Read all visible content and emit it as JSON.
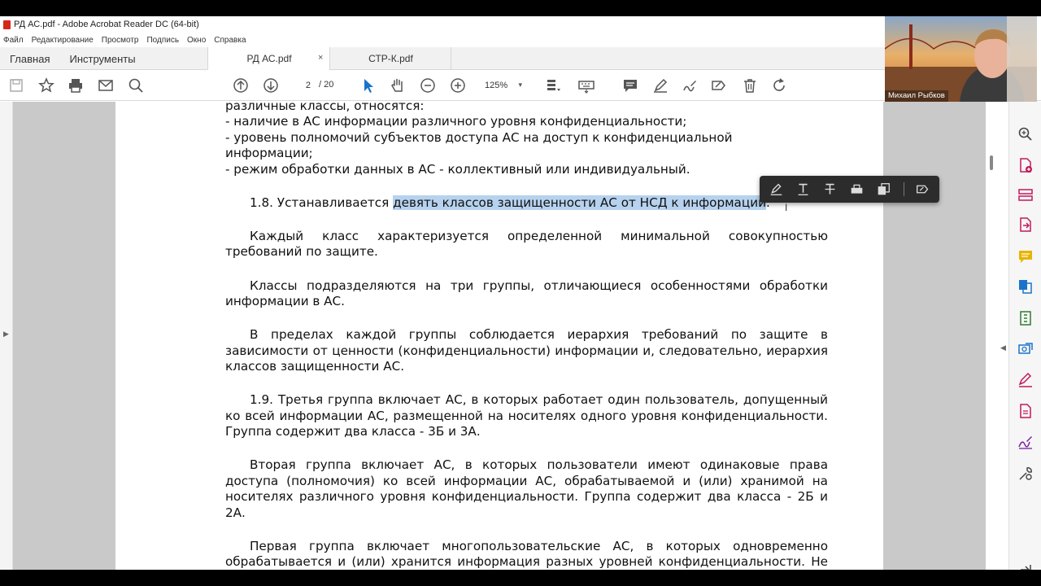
{
  "window": {
    "title": "РД АС.pdf - Adobe Acrobat Reader DC (64-bit)"
  },
  "menu": [
    "Файл",
    "Редактирование",
    "Просмотр",
    "Подпись",
    "Окно",
    "Справка"
  ],
  "tabs": {
    "home": "Главная",
    "tools": "Инструменты",
    "documents": [
      {
        "label": "РД АС.pdf",
        "close": "×"
      },
      {
        "label": "СТР-К.pdf"
      }
    ]
  },
  "toolbar": {
    "page_current": "2",
    "page_total": "/ 20",
    "zoom": "125%"
  },
  "webcam": {
    "name": "Михаил Рыбков"
  },
  "document": {
    "lines_top": [
      "различные классы, относятся:",
      "- наличие в АС информации различного уровня конфиденциальности;",
      "- уровень полномочий субъектов доступа АС на доступ к конфиденциальной",
      "информации;",
      "- режим обработки данных в АС - коллективный или индивидуальный."
    ],
    "p18_prefix": "1.8. Устанавливается ",
    "p18_highlight": "девять классов защищенности АС от НСД к информации",
    "p18_suffix": ".",
    "p_each_class": "Каждый класс характеризуется определенной минимальной совокупностью требований по защите.",
    "p_classes_groups": "Классы подразделяются на три группы, отличающиеся особенностями обработки информации в АС.",
    "p_hierarchy": "В пределах каждой группы соблюдается иерархия требований по защите в зависимости от ценности (конфиденциальности) информации и, следовательно, иерархия классов защищенности АС.",
    "p19": "1.9. Третья группа включает АС, в которых работает один пользователь, допущенный ко всей информации АС, размещенной на носителях одного уровня конфиденциальности. Группа содержит два класса - 3Б и 3А.",
    "p_second": "Вторая группа включает АС, в которых пользователи имеют одинаковые права доступа (полномочия) ко всей информации АС, обрабатываемой и (или) хранимой на носителях различного уровня конфиденциальности. Группа содержит два класса - 2Б и 2А.",
    "p_first": "Первая группа включает многопользовательские АС, в которых одновременно обрабатывается и (или) хранится информация разных уровней конфиденциальности. Не все пользователи имеют право доступа ко всей информации АС. Группа содержит"
  },
  "colors": {
    "highlight": "#b6d2ee",
    "right_panel_icon_accent": "#c2185b"
  }
}
